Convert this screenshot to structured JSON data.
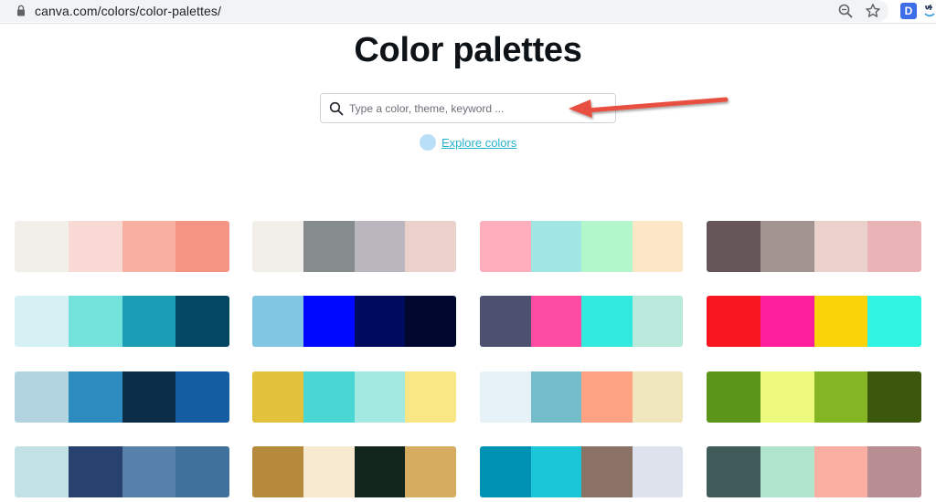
{
  "browser": {
    "url": "canva.com/colors/color-palettes/",
    "extension_badge": "D"
  },
  "page": {
    "title": "Color palettes",
    "search_placeholder": "Type a color, theme, keyword ...",
    "explore_label": "Explore colors"
  },
  "icons": {
    "lock": "lock-icon",
    "zoom": "zoom-out-icon",
    "star": "star-icon",
    "search": "search-icon",
    "arrow": "red-arrow-annotation-icon"
  },
  "colors": {
    "accent_link": "#27b3cc",
    "explore_dot": "#b9def8",
    "arrow_red": "#e8503f"
  },
  "palettes": [
    [
      "#f2efea",
      "#f9d9d4",
      "#f9b0a1",
      "#f79585"
    ],
    [
      "#f2efea",
      "#868b8e",
      "#b9b7bd",
      "#ead1cb"
    ],
    [
      "#feaebd",
      "#a2e6e4",
      "#b2f6cc",
      "#fbe6c7"
    ],
    [
      "#665659",
      "#a29491",
      "#ead1cb",
      "#eab4b7"
    ],
    [
      "#d5f1f4",
      "#72e2da",
      "#1b9db5",
      "#034762"
    ],
    [
      "#81c7e3",
      "#0008fd",
      "#000b5d",
      "#00062e"
    ],
    [
      "#4c516f",
      "#fb4ca2",
      "#31e9dd",
      "#baeadc"
    ],
    [
      "#f7151f",
      "#fd1e9c",
      "#fad309",
      "#31f4e2"
    ],
    [
      "#b1d4e0",
      "#2e8bc0",
      "#0c2d48",
      "#145da0"
    ],
    [
      "#e2c13d",
      "#4ad6d3",
      "#a3e9e2",
      "#f9e786"
    ],
    [
      "#e6f1f8",
      "#76bdcb",
      "#fda283",
      "#efe6be"
    ],
    [
      "#5b961a",
      "#edf97c",
      "#84b523",
      "#3b580d"
    ],
    [
      "#c2e1e5",
      "#27426e",
      "#5780aa",
      "#40719c"
    ],
    [
      "#b58a3c",
      "#f7ead1",
      "#12261d",
      "#d6ac60"
    ],
    [
      "#0092b5",
      "#1bc6d9",
      "#8a7264",
      "#dee2ec"
    ],
    [
      "#3f5c5b",
      "#b1e4cd",
      "#fbaea2",
      "#b98e92"
    ]
  ]
}
